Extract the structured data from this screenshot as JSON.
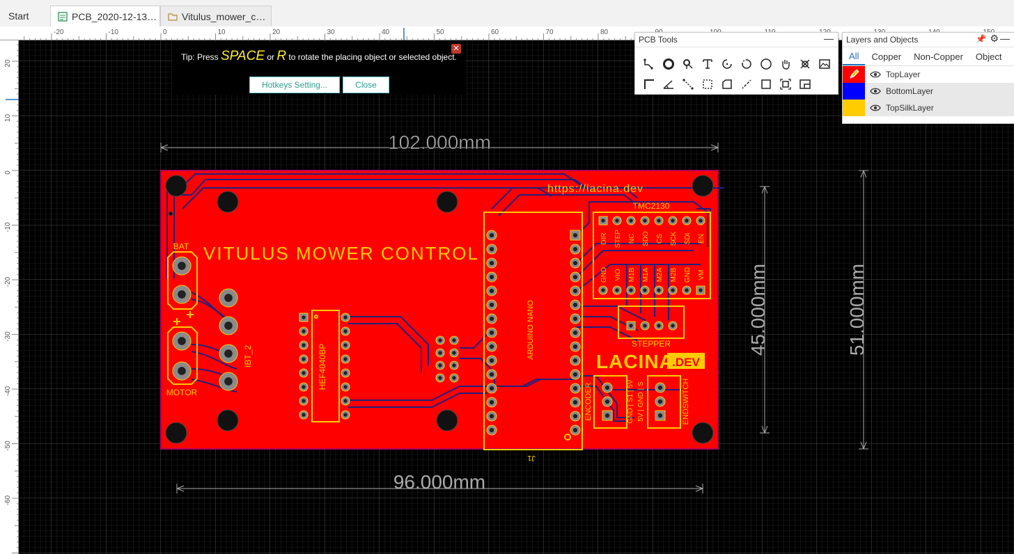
{
  "tabs": {
    "start": "Start",
    "pcb": "PCB_2020-12-13…",
    "project": "Vitulus_mower_c…"
  },
  "ruler": {
    "top": [
      "-20",
      "-10",
      "0",
      "10",
      "20",
      "30",
      "40",
      "50",
      "60",
      "70",
      "80",
      "90",
      "100",
      "110",
      "120",
      "130",
      "140",
      "150"
    ],
    "left": [
      "20",
      "10",
      "0",
      "-10",
      "-20",
      "-30",
      "-40",
      "-50",
      "-60"
    ]
  },
  "tip": {
    "prefix": "Tip: Press ",
    "key1": "SPACE",
    "or": " or ",
    "key2": "R",
    "suffix": " to rotate the placing object or selected object.",
    "hotkeys_button": "Hotkeys Setting...",
    "close_button": "Close"
  },
  "pcb_tools": {
    "title": "PCB Tools",
    "tools": [
      "track-icon",
      "pad-icon",
      "via-icon",
      "text-icon",
      "arc-icon",
      "center-arc-icon",
      "circle-icon",
      "pan-icon",
      "solder-mask-icon",
      "image-icon",
      "rectangle-corner-icon",
      "angle-icon",
      "connect-icon",
      "dashed-rect-icon",
      "polygon-icon",
      "route-icon",
      "rectangle-icon",
      "select-area-icon",
      "board-outline-icon"
    ]
  },
  "layers": {
    "title": "Layers and Objects",
    "tabs": [
      "All",
      "Copper",
      "Non-Copper",
      "Object"
    ],
    "items": [
      {
        "name": "TopLayer",
        "color": "#ff0000"
      },
      {
        "name": "BottomLayer",
        "color": "#0000ff"
      },
      {
        "name": "TopSilkLayer",
        "color": "#ffcc00"
      }
    ]
  },
  "board": {
    "dim_top": "102.000mm",
    "dim_bottom": "96.000mm",
    "dim_right_inner": "45.000mm",
    "dim_right_outer": "51.000mm",
    "title": "VITULUS MOWER CONTROL",
    "url": "https://lacina.dev",
    "logo_main": "LACINA",
    "logo_suffix": ".DEV",
    "bat": "BAT",
    "motor": "MOTOR",
    "ibt": "IBT_2",
    "plus": "+",
    "hef": "HEF4040BP",
    "arduino": "ARDUINO NANO",
    "j1": "J1",
    "tmc": "TMC2130",
    "tmc_top": [
      "DIR",
      "STEP",
      "NC",
      "SDO",
      "CS",
      "SCK",
      "SDI",
      "EN"
    ],
    "tmc_bottom": [
      "GND",
      "VIO",
      "M1B",
      "M1A",
      "M2A",
      "M2B",
      "GND",
      "VM"
    ],
    "stepper": "STEPPER",
    "encoder": "ENCODER",
    "endswitch": "ENDSWITCH",
    "enc_pins": "GND | S1 | 5V",
    "end_pins": "5V | GND | S"
  },
  "colors": {
    "board": "#ff0000",
    "silk": "#ffcc00",
    "bottom": "#1a1a80",
    "canvas": "#000000"
  }
}
